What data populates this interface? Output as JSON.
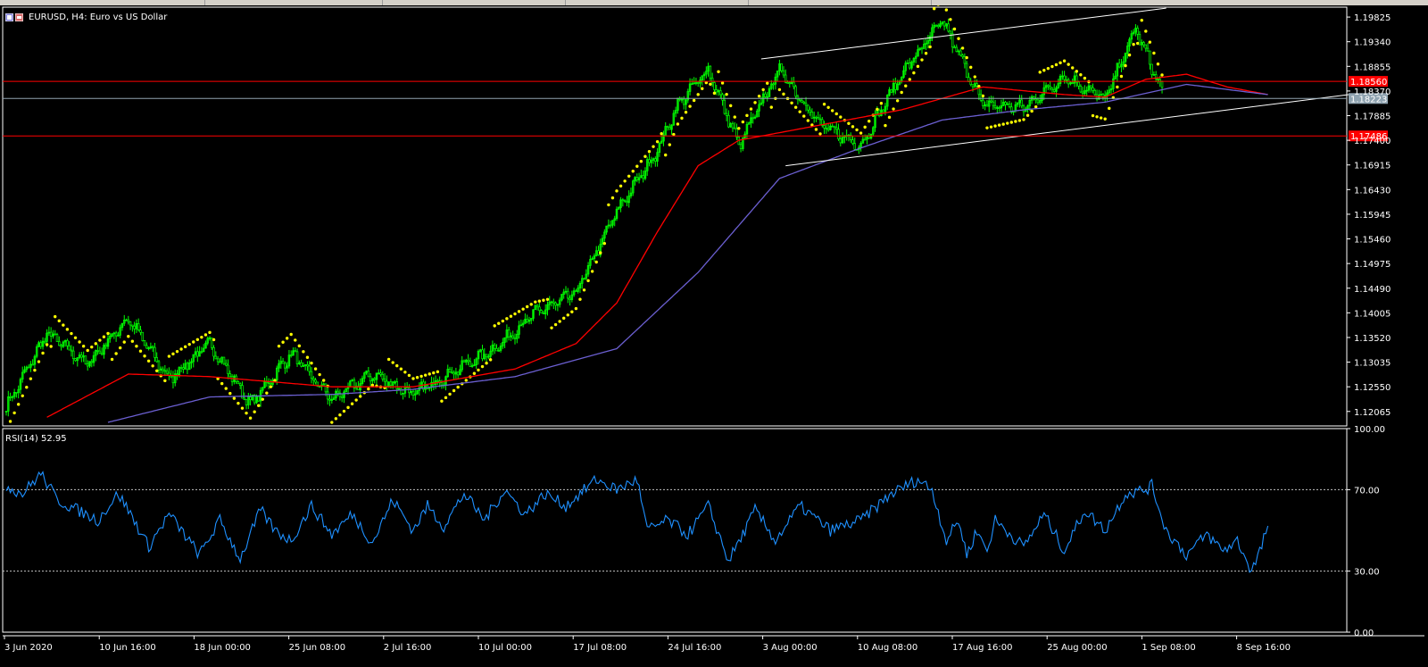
{
  "window": {
    "symbol_title": "EURUSD, H4:  Euro vs US Dollar"
  },
  "colors": {
    "background": "#000000",
    "axis_text": "#ffffff",
    "bull_candle": "#00ff00",
    "sma_fast": "#ff0000",
    "sma_slow": "#6b5fd1",
    "parabolic_sar": "#ffff00",
    "channel_lines": "#ffffff",
    "horizontal_levels": "#ff0000",
    "bid_line": "#8fa3b0",
    "rsi_line": "#1e90ff",
    "rsi_levels": "#c0c0c0"
  },
  "chart_data": [
    {
      "type": "candlestick",
      "title": "EURUSD, H4:  Euro vs US Dollar",
      "ylim": [
        1.1178,
        1.2002
      ],
      "y_ticks": [
        "1.19825",
        "1.19340",
        "1.18855",
        "1.18370",
        "1.17885",
        "1.17400",
        "1.16915",
        "1.16430",
        "1.15945",
        "1.15460",
        "1.14975",
        "1.14490",
        "1.14005",
        "1.13520",
        "1.13035",
        "1.12550",
        "1.12065"
      ],
      "x_tick_labels": [
        "3 Jun 2020",
        "10 Jun 16:00",
        "18 Jun 00:00",
        "25 Jun 08:00",
        "2 Jul 16:00",
        "10 Jul 00:00",
        "17 Jul 08:00",
        "24 Jul 16:00",
        "3 Aug 00:00",
        "10 Aug 08:00",
        "17 Aug 16:00",
        "25 Aug 00:00",
        "1 Sep 08:00",
        "8 Sep 16:00"
      ],
      "price_anchors_x": [
        0,
        20,
        40,
        60,
        80,
        100,
        120,
        140,
        160,
        180,
        200,
        222,
        240,
        260,
        280,
        300,
        320,
        330,
        345,
        360,
        380,
        400,
        420,
        440,
        460,
        480,
        500,
        520,
        540,
        555,
        568
      ],
      "price_anchors_y": [
        1.1215,
        1.136,
        1.13,
        1.139,
        1.127,
        1.134,
        1.122,
        1.132,
        1.123,
        1.128,
        1.124,
        1.129,
        1.133,
        1.14,
        1.144,
        1.16,
        1.172,
        1.181,
        1.188,
        1.173,
        1.188,
        1.177,
        1.173,
        1.187,
        1.1975,
        1.181,
        1.1805,
        1.1865,
        1.182,
        1.196,
        1.1835
      ],
      "series": [
        {
          "name": "sma_fast",
          "anchors_x": [
            20,
            60,
            100,
            160,
            200,
            250,
            280,
            300,
            320,
            340,
            360,
            400,
            440,
            480,
            520,
            540,
            560,
            580,
            600,
            620
          ],
          "anchors_y": [
            1.1195,
            1.128,
            1.1275,
            1.1255,
            1.1255,
            1.129,
            1.134,
            1.142,
            1.156,
            1.169,
            1.174,
            1.177,
            1.18,
            1.1845,
            1.183,
            1.1825,
            1.186,
            1.187,
            1.1845,
            1.183
          ]
        },
        {
          "name": "sma_slow",
          "anchors_x": [
            50,
            100,
            160,
            200,
            250,
            300,
            340,
            380,
            420,
            460,
            500,
            540,
            580,
            620
          ],
          "anchors_y": [
            1.1185,
            1.1235,
            1.124,
            1.125,
            1.1275,
            1.133,
            1.148,
            1.1665,
            1.1725,
            1.178,
            1.18,
            1.1815,
            1.185,
            1.183
          ]
        }
      ],
      "channel_lines": [
        {
          "from": [
            1.19,
            371
          ],
          "to": [
            1.2,
            570
          ]
        },
        {
          "from": [
            1.169,
            383
          ],
          "to": [
            1.183,
            660
          ]
        }
      ],
      "horizontal_levels": [
        {
          "value": 1.1856,
          "label": "1.18560"
        },
        {
          "value": 1.17486,
          "label": "1.17486"
        }
      ],
      "bid": {
        "value": 1.18223,
        "label": "1.18223"
      }
    },
    {
      "type": "line",
      "title": "RSI(14) 52.95",
      "ylim": [
        0,
        100
      ],
      "y_ticks": [
        "100.00",
        "70.00",
        "30.00",
        "0.00"
      ],
      "levels": [
        70,
        30
      ],
      "anchors_x": [
        0,
        8,
        17,
        25,
        35,
        45,
        55,
        60,
        70,
        80,
        95,
        105,
        115,
        125,
        132,
        140,
        150,
        160,
        170,
        180,
        190,
        200,
        207,
        215,
        225,
        235,
        245,
        255,
        265,
        275,
        290,
        300,
        310,
        315,
        325,
        335,
        345,
        355,
        363,
        368,
        378,
        390,
        405,
        420,
        435,
        448,
        455,
        462,
        468,
        472,
        477,
        482,
        486,
        500,
        510,
        520,
        530,
        540,
        550,
        560,
        563,
        570,
        580,
        590,
        598,
        605,
        612,
        617,
        620
      ],
      "anchors_y": [
        72,
        68,
        78,
        65,
        60,
        55,
        68,
        60,
        42,
        58,
        38,
        55,
        36,
        60,
        50,
        45,
        62,
        48,
        58,
        44,
        65,
        50,
        62,
        52,
        68,
        55,
        70,
        58,
        68,
        62,
        75,
        70,
        75,
        50,
        55,
        48,
        62,
        35,
        50,
        60,
        45,
        62,
        50,
        55,
        68,
        75,
        70,
        45,
        55,
        38,
        50,
        40,
        55,
        42,
        58,
        40,
        60,
        50,
        68,
        70,
        72,
        50,
        38,
        48,
        40,
        45,
        30,
        42,
        53
      ]
    }
  ]
}
